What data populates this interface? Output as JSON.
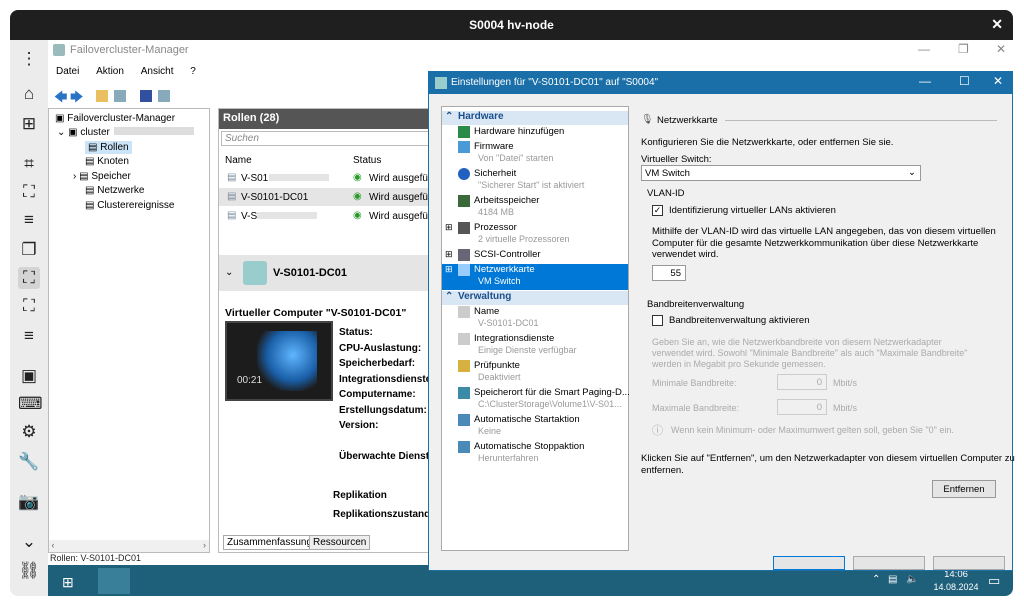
{
  "window_title": "S0004 hv-node",
  "close_glyph": "✕",
  "toolbar_icons": [
    "more-vert-icon",
    "home-icon",
    "new-window-icon",
    "focus-icon",
    "fullscreen-icon",
    "menu-icon",
    "windows-icon",
    "screen-select-icon",
    "fit-screen-icon",
    "menu-icon",
    "app-icon",
    "keyboard-icon",
    "settings-icon",
    "wrench-icon",
    "camera-icon",
    "chevron-down-icon",
    "disconnect-icon"
  ],
  "fcm": {
    "title": "Failovercluster-Manager",
    "menu": [
      "Datei",
      "Aktion",
      "Ansicht",
      "?"
    ],
    "tree": [
      {
        "label": "Failovercluster-Manager"
      },
      {
        "label": "cluster"
      },
      {
        "label": "Rollen"
      },
      {
        "label": "Knoten"
      },
      {
        "label": "Speicher"
      },
      {
        "label": "Netzwerke"
      },
      {
        "label": "Clusterereignisse"
      }
    ],
    "roles_header": "Rollen (28)",
    "search_placeholder": "Suchen",
    "col_name": "Name",
    "col_status": "Status",
    "rows": [
      {
        "name": "V-S01",
        "status": "Wird ausgeführt"
      },
      {
        "name": "V-S0101-DC01",
        "status": "Wird ausgeführt"
      },
      {
        "name": "V-S",
        "status": "Wird ausgeführt"
      }
    ],
    "detail_name": "V-S0101-DC01",
    "detail_title": "Virtueller Computer \"V-S0101-DC01\"",
    "thumb_time": "00:21",
    "props": [
      "Status:",
      "CPU-Auslastung:",
      "Speicherbedarf:",
      "Integrationsdienste:",
      "Computername:",
      "Erstellungsdatum:",
      "Version:",
      "Überwachte Dienste:",
      "Replikation",
      "Replikationszustand:"
    ],
    "tabs": [
      "Zusammenfassung",
      "Ressourcen"
    ],
    "status_bar": "Rollen:  V-S0101-DC01"
  },
  "dialog": {
    "title": "Einstellungen für \"V-S0101-DC01\" auf \"S0004\"",
    "sections": [
      "Hardware",
      "Verwaltung"
    ],
    "hardware": [
      {
        "l1": "Hardware hinzufügen",
        "l2": ""
      },
      {
        "l1": "Firmware",
        "l2": "Von \"Datei\" starten"
      },
      {
        "l1": "Sicherheit",
        "l2": "\"Sicherer Start\" ist aktiviert"
      },
      {
        "l1": "Arbeitsspeicher",
        "l2": "4184 MB"
      },
      {
        "l1": "Prozessor",
        "l2": "2 virtuelle Prozessoren"
      },
      {
        "l1": "SCSI-Controller",
        "l2": ""
      },
      {
        "l1": "Netzwerkkarte",
        "l2": "VM Switch"
      }
    ],
    "management": [
      {
        "l1": "Name",
        "l2": "V-S0101-DC01"
      },
      {
        "l1": "Integrationsdienste",
        "l2": "Einige Dienste verfügbar"
      },
      {
        "l1": "Prüfpunkte",
        "l2": "Deaktiviert"
      },
      {
        "l1": "Speicherort für die Smart Paging-D...",
        "l2": "C:\\ClusterStorage\\Volume1\\V-S01..."
      },
      {
        "l1": "Automatische Startaktion",
        "l2": "Keine"
      },
      {
        "l1": "Automatische Stoppaktion",
        "l2": "Herunterfahren"
      }
    ],
    "group": "Netzwerkkarte",
    "intro": "Konfigurieren Sie die Netzwerkkarte, oder entfernen Sie sie.",
    "switch_label": "Virtueller Switch:",
    "switch_value": "VM Switch",
    "vlan_label": "VLAN-ID",
    "vlan_check": "Identifizierung virtueller LANs aktivieren",
    "vlan_help": [
      "Mithilfe der VLAN-ID wird das virtuelle LAN angegeben, das von diesem virtuellen",
      "Computer für die gesamte Netzwerkkommunikation über diese Netzwerkkarte",
      "verwendet wird."
    ],
    "vlan_value": "55",
    "bw_label": "Bandbreitenverwaltung",
    "bw_check": "Bandbreitenverwaltung aktivieren",
    "bw_help": [
      "Geben Sie an, wie die Netzwerkbandbreite von diesem Netzwerkadapter",
      "verwendet wird. Sowohl \"Minimale Bandbreite\" als auch \"Maximale Bandbreite\"",
      "werden in Megabit pro Sekunde gemessen."
    ],
    "min_label": "Minimale Bandbreite:",
    "max_label": "Maximale Bandbreite:",
    "min_value": "0",
    "max_value": "0",
    "unit": "Mbit/s",
    "bw_note": "Wenn kein Minimum- oder Maximumwert gelten soll, geben Sie \"0\" ein.",
    "remove_help": [
      "Klicken Sie auf \"Entfernen\", um den Netzwerkadapter von diesem virtuellen Computer zu",
      "entfernen."
    ],
    "remove_button": "Entfernen"
  },
  "taskbar": {
    "time": "14:06",
    "date": "14.08.2024"
  }
}
